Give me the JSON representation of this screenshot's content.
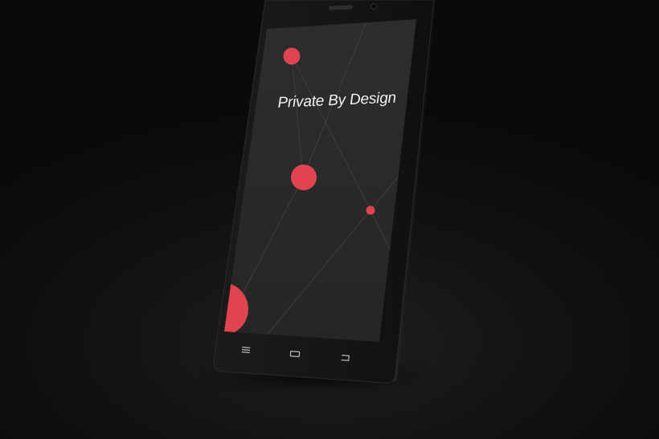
{
  "wallpaper": {
    "title": "Private By Design"
  },
  "navigation_bar": {
    "buttons": [
      {
        "name": "menu-icon"
      },
      {
        "name": "home-icon"
      },
      {
        "name": "back-icon"
      }
    ]
  },
  "colors": {
    "background": "#0e0e0f",
    "phone_body": "#151515",
    "screen": "#2b2b2c",
    "accent_red": "#e0444e",
    "network_lines": "#3d3d3e"
  }
}
